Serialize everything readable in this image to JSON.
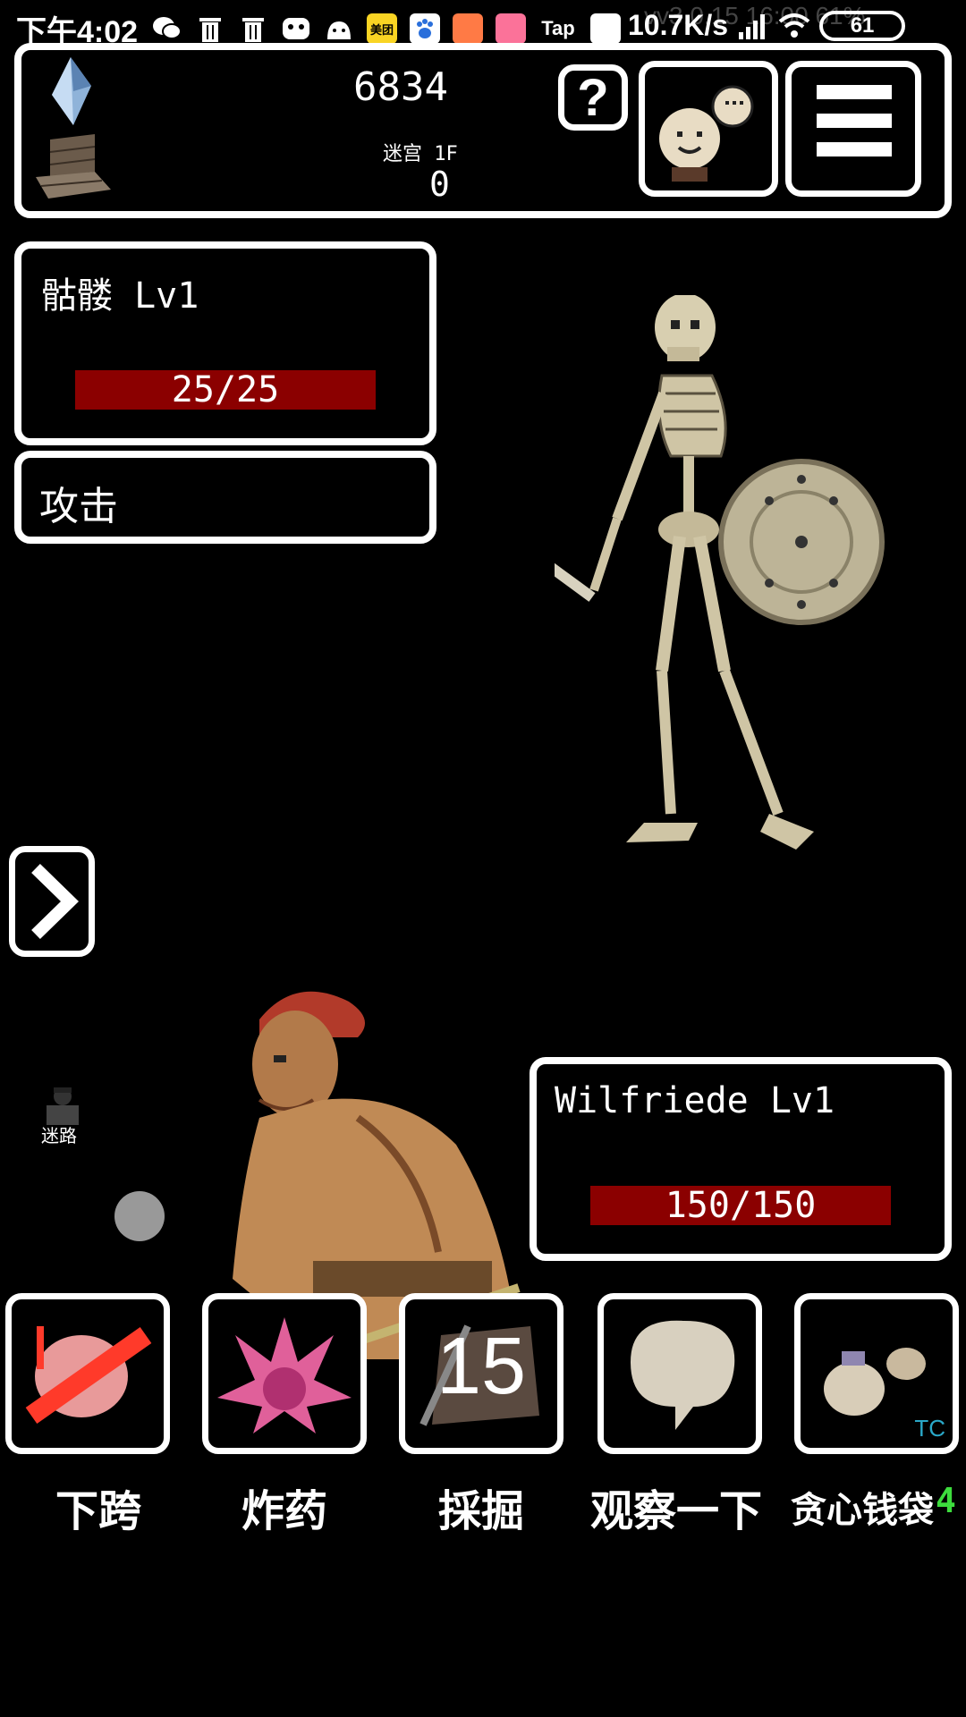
{
  "status_bar": {
    "time": "下午4:02",
    "app_icons": [
      "wechat-icon",
      "trash-icon",
      "trash-icon",
      "game-icon",
      "android-icon",
      "meituan-icon",
      "baidu-icon",
      "shop-icon",
      "bilibili-icon",
      "taptap-icon",
      "mi-icon"
    ],
    "meituan_label": "美团",
    "tap_label": "Tap",
    "more": "···",
    "net_speed": "10.7K/s",
    "battery": "61",
    "overlay_text": "vv3.0.15 16:00 61%"
  },
  "header": {
    "gems": "6834",
    "floor_label": "迷宫 1F",
    "floor_value": "0",
    "help_label": "?"
  },
  "enemy": {
    "name": "骷髅 Lv1",
    "hp": "25/25",
    "hp_fraction": 1.0
  },
  "action": {
    "text": "攻击"
  },
  "player": {
    "name": "Wilfriede Lv1",
    "hp": "150/150",
    "hp_fraction": 1.0
  },
  "side": {
    "lost_label": "迷路"
  },
  "skills": [
    {
      "label": "下跨",
      "icon": "descend-icon"
    },
    {
      "label": "炸药",
      "icon": "dynamite-icon"
    },
    {
      "label": "採掘",
      "icon": "dig-icon",
      "badge": "15"
    },
    {
      "label": "观察一下",
      "icon": "observe-icon"
    },
    {
      "label": "贪心钱袋",
      "icon": "money-bag-icon",
      "count": "4",
      "tag": "TC"
    }
  ],
  "colors": {
    "hp_bar": "#8b0000",
    "count_green": "#3ddc3d",
    "background": "#000000",
    "frame": "#ffffff"
  }
}
